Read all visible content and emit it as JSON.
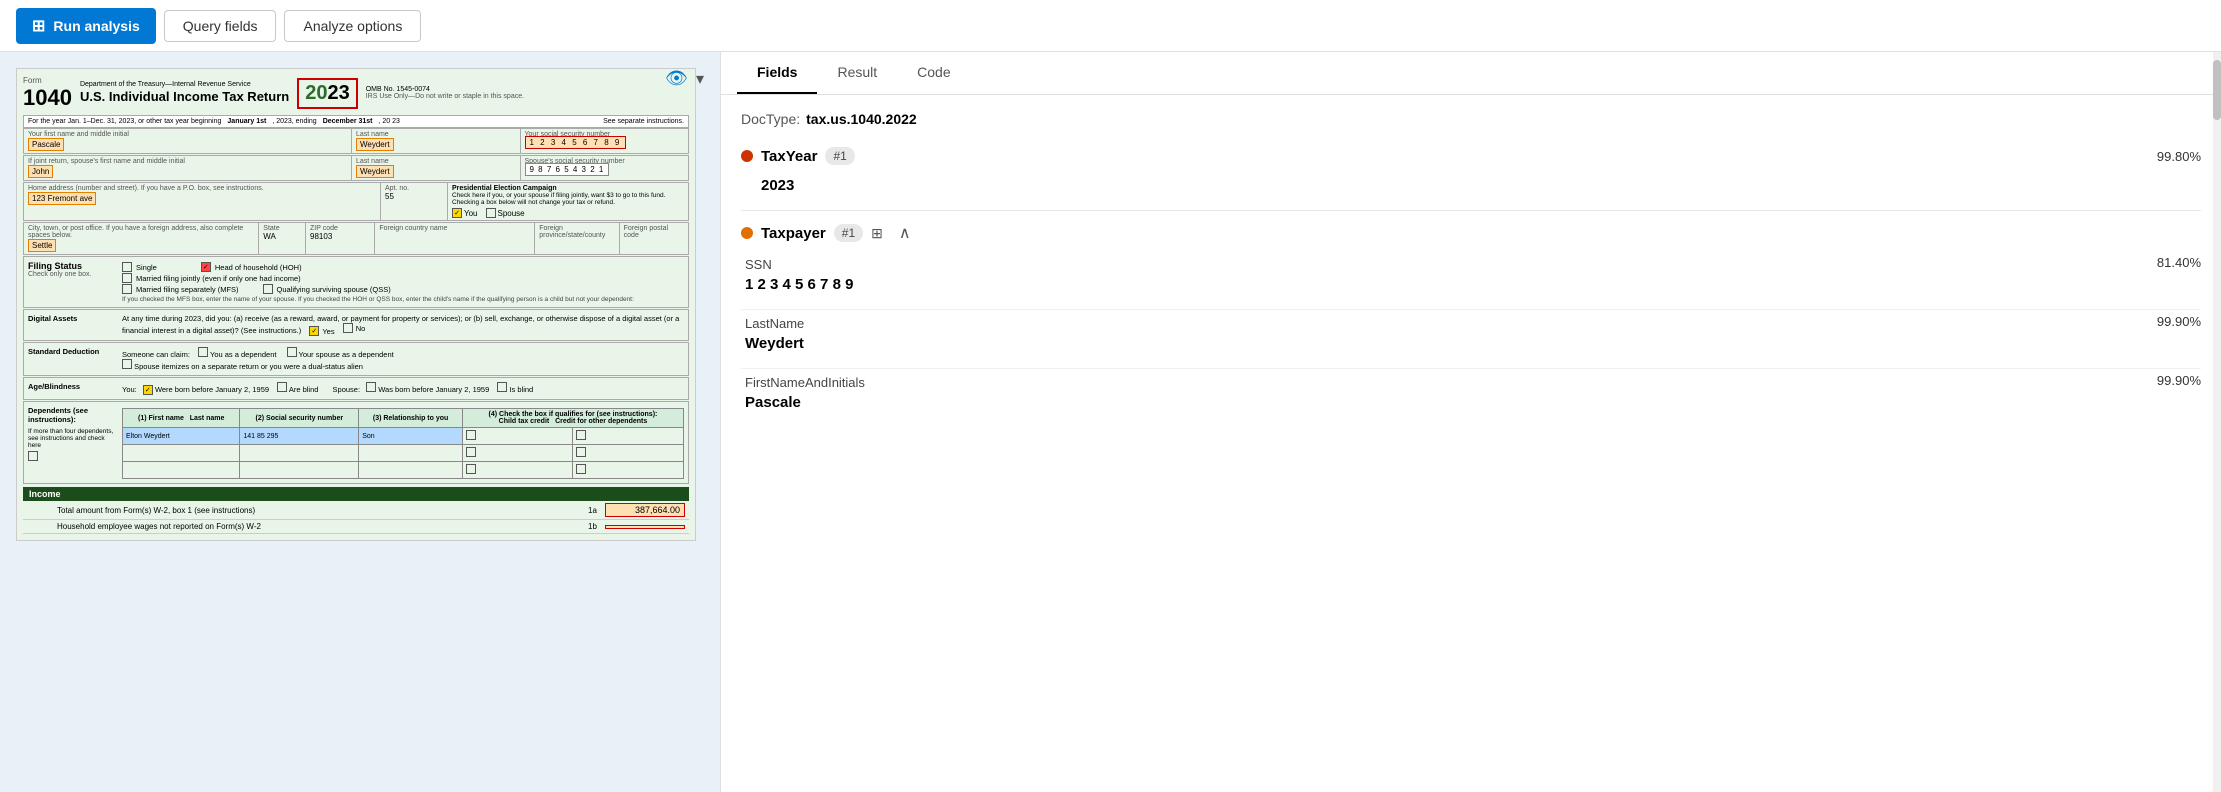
{
  "toolbar": {
    "run_label": "Run analysis",
    "query_fields_label": "Query fields",
    "analyze_options_label": "Analyze options"
  },
  "tabs": {
    "fields": "Fields",
    "result": "Result",
    "code": "Code",
    "active": "fields"
  },
  "right_panel": {
    "doctype_label": "DocType:",
    "doctype_value": "tax.us.1040.2022",
    "tax_year": {
      "label": "TaxYear",
      "badge": "#1",
      "confidence": "99.80%",
      "value": "2023",
      "dot_color": "red"
    },
    "taxpayer": {
      "label": "Taxpayer",
      "badge": "#1",
      "dot_color": "orange",
      "fields": [
        {
          "name": "SSN",
          "confidence": "81.40%",
          "value": "1 2 3 4 5 6 7 8 9"
        },
        {
          "name": "LastName",
          "confidence": "99.90%",
          "value": "Weydert"
        },
        {
          "name": "FirstNameAndInitials",
          "confidence": "99.90%",
          "value": "Pascale"
        }
      ]
    }
  },
  "form": {
    "year": "2023",
    "year_colored": "20",
    "year_plain": "23",
    "omb": "OMB No. 1545-0074",
    "tax_year_range": "For the year Jan. 1–Dec. 31, 2023, or other tax year beginning",
    "beginning": "January 1st",
    "ending_label": ", 2023, ending",
    "ending": "December 31st",
    "ending_year": ", 20 23",
    "sep_instructions": "See separate instructions.",
    "first_name_label": "Your first name and middle initial",
    "first_name": "Pascale",
    "last_name_label": "Last name",
    "last_name": "Weydert",
    "ssn_label": "Your social security number",
    "ssn": "1 2 3 4 5 6 7 8 9",
    "spouse_name_label": "If joint return, spouse's first name and middle initial",
    "spouse_name": "John",
    "spouse_last_label": "Last name",
    "spouse_last": "Weydert",
    "spouse_ssn_label": "Spouse's social security number",
    "spouse_ssn": "9 8 7 6 5 4 3 2 1",
    "address_label": "Home address (number and street). If you have a P.O. box, see instructions.",
    "address": "123 Fremont ave",
    "apt_label": "Apt. no.",
    "apt": "55",
    "city_label": "City, town, or post office. If you have a foreign address, also complete spaces below.",
    "city": "Settle",
    "state_label": "State",
    "state": "WA",
    "zip_label": "ZIP code",
    "zip": "98103",
    "pec_label": "Presidential Election Campaign",
    "pec_text": "Check here if you, or your spouse if filing jointly, want $3 to go to this fund. Checking a box below will not change your tax or refund.",
    "pec_you_label": "You",
    "pec_spouse_label": "Spouse",
    "income_1a_label": "Total amount from Form(s) W-2, box 1 (see instructions)",
    "income_1a_ref": "1a",
    "income_1a_amt": "387,664.00",
    "income_1b_label": "Household employee wages not reported on Form(s) W-2",
    "income_1b_ref": "1b"
  }
}
